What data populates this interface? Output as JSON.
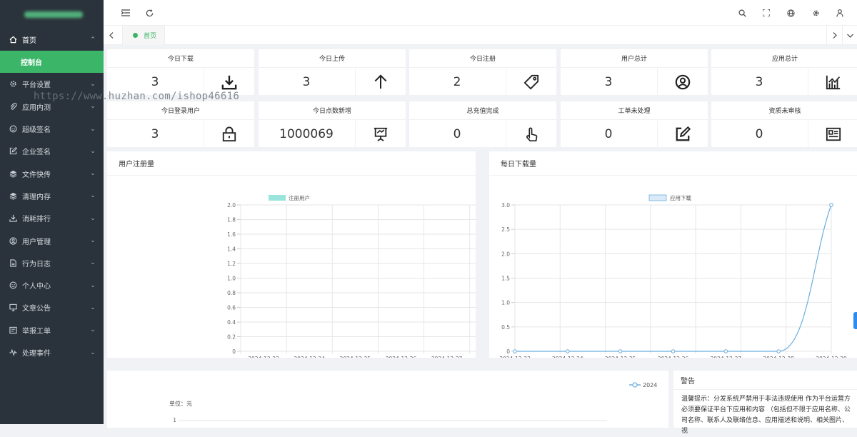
{
  "sidebar": {
    "menu": [
      {
        "label": "首页",
        "icon": "home-icon",
        "open": true
      },
      {
        "label": "平台设置",
        "icon": "gear-icon"
      },
      {
        "label": "应用内测",
        "icon": "paperclip-icon"
      },
      {
        "label": "超级签名",
        "icon": "smile-icon"
      },
      {
        "label": "企业签名",
        "icon": "edit-icon"
      },
      {
        "label": "文件快传",
        "icon": "layers-icon"
      },
      {
        "label": "清理内存",
        "icon": "layers-icon"
      },
      {
        "label": "消耗排行",
        "icon": "download-icon"
      },
      {
        "label": "用户管理",
        "icon": "user-circle-icon"
      },
      {
        "label": "行为日志",
        "icon": "document-icon"
      },
      {
        "label": "个人中心",
        "icon": "smile-icon"
      },
      {
        "label": "文章公告",
        "icon": "monitor-icon"
      },
      {
        "label": "举报工单",
        "icon": "cards-icon"
      },
      {
        "label": "处理事件",
        "icon": "pulse-icon"
      }
    ],
    "submenu_active": "控制台"
  },
  "tabs": {
    "current": "首页"
  },
  "stats": [
    {
      "label": "今日下载",
      "value": "3",
      "icon": "download-icon"
    },
    {
      "label": "今日上传",
      "value": "3",
      "icon": "arrow-up-icon"
    },
    {
      "label": "今日注册",
      "value": "2",
      "icon": "tag-icon"
    },
    {
      "label": "用户总计",
      "value": "3",
      "icon": "user-circle-icon"
    },
    {
      "label": "应用总计",
      "value": "3",
      "icon": "chart-icon"
    },
    {
      "label": "今日登录用户",
      "value": "3",
      "icon": "lock-icon"
    },
    {
      "label": "今日点数新增",
      "value": "1000069",
      "icon": "presentation-icon"
    },
    {
      "label": "总充值完成",
      "value": "0",
      "icon": "touch-icon"
    },
    {
      "label": "工单未处理",
      "value": "0",
      "icon": "edit-icon"
    },
    {
      "label": "资质未审核",
      "value": "0",
      "icon": "id-card-icon"
    }
  ],
  "panels": {
    "register_title": "用户注册量",
    "download_title": "每日下载量",
    "warning_title": "警告",
    "warning_text": "温馨提示：分发系统严禁用于非法违规使用 作为平台运营方必须要保证平台下应用和内容 （包括但不限于应用名称、公司名称、联系人及联络信息、应用描述和说明、相关图片、视",
    "revenue_unit": "单位：元"
  },
  "watermark": "https://www.huzhan.com/ishop46616",
  "colors": {
    "accent": "#3bb567",
    "sidebar": "#2a333b",
    "bar": "#99e4dc",
    "line": "#6aaee0"
  },
  "chart_data": [
    {
      "type": "bar",
      "categories": [
        "2024-12-23",
        "2024-12-24",
        "2024-12-25",
        "2024-12-26",
        "2024-12-27",
        "2024-12-28",
        "2024-12-29"
      ],
      "series": [
        {
          "name": "注册用户",
          "values": [
            0,
            0,
            0,
            0,
            0,
            0,
            2
          ]
        }
      ],
      "ylim": [
        0,
        2.0
      ],
      "yticks": [
        "0",
        "0.2",
        "0.4",
        "0.6",
        "0.8",
        "1.0",
        "1.2",
        "1.4",
        "1.6",
        "1.8",
        "2.0"
      ],
      "legend": "top-center",
      "grid": true
    },
    {
      "type": "line",
      "categories": [
        "2024-12-23",
        "2024-12-24",
        "2024-12-25",
        "2024-12-26",
        "2024-12-27",
        "2024-12-28",
        "2024-12-29"
      ],
      "series": [
        {
          "name": "应用下载",
          "values": [
            0,
            0,
            0,
            0,
            0,
            0,
            3
          ]
        }
      ],
      "ylim": [
        0,
        3.0
      ],
      "yticks": [
        "0",
        "0.5",
        "1.0",
        "1.5",
        "2.0",
        "2.5",
        "3.0"
      ],
      "legend": "top-center",
      "grid": true
    },
    {
      "type": "line",
      "series": [
        {
          "name": "2024",
          "values": []
        }
      ],
      "ylim": [
        0,
        1
      ],
      "yticks": [
        "1"
      ],
      "legend": "top-right"
    }
  ]
}
